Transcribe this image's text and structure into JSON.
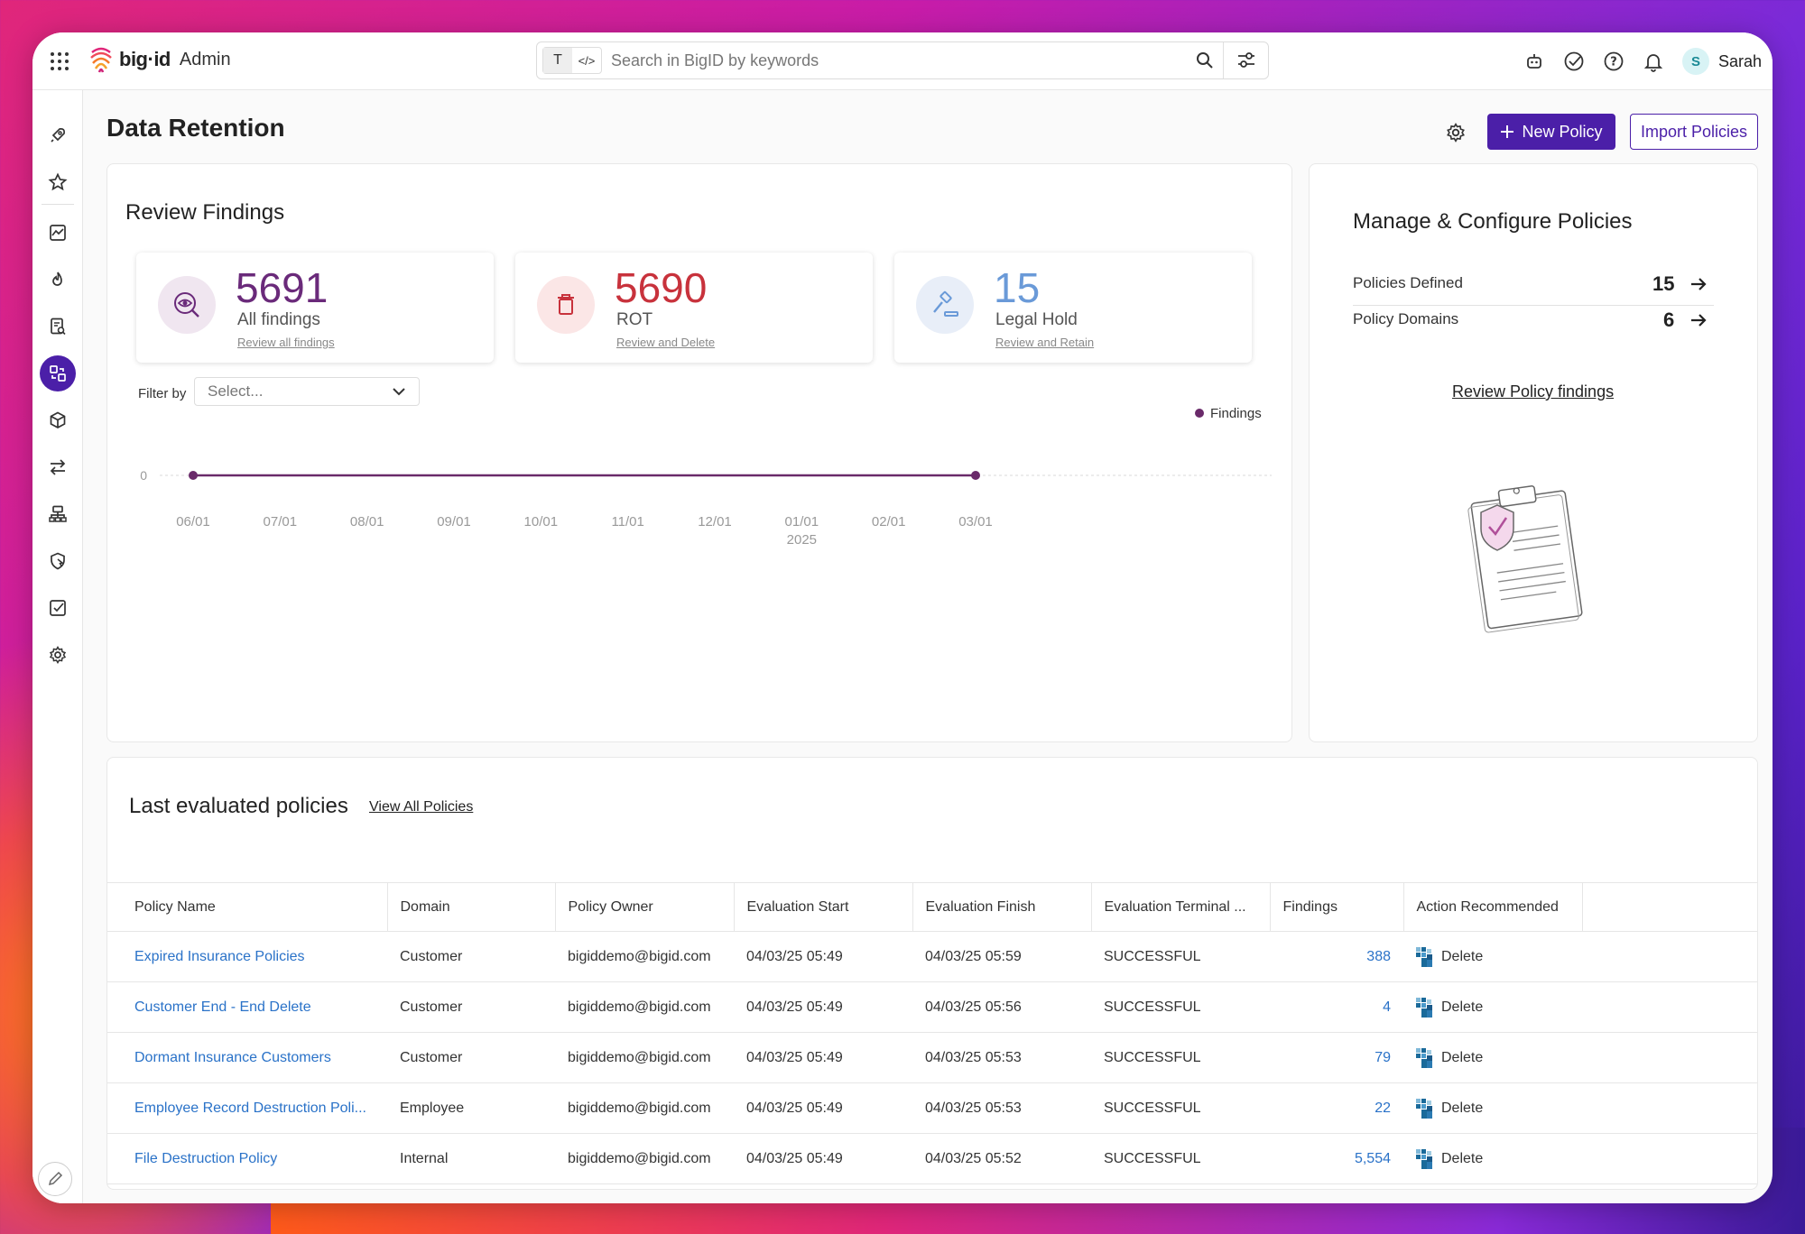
{
  "app": {
    "brand": "big·id",
    "product": "Admin",
    "user_initial": "S",
    "user_name": "Sarah"
  },
  "search": {
    "placeholder": "Search in BigID by keywords",
    "mode_text": "T",
    "mode_code": "</>"
  },
  "page": {
    "title": "Data Retention",
    "new_policy_label": "New Policy",
    "import_label": "Import Policies"
  },
  "review": {
    "title": "Review Findings",
    "stats": [
      {
        "value": "5691",
        "label": "All findings",
        "link": "Review all findings",
        "color": "#6a2a7a"
      },
      {
        "value": "5690",
        "label": "ROT",
        "link": "Review and Delete",
        "color": "#c8323c"
      },
      {
        "value": "15",
        "label": "Legal Hold",
        "link": "Review and Retain",
        "color": "#6a9ad8"
      }
    ],
    "filter_label": "Filter by",
    "filter_placeholder": "Select..."
  },
  "chart_data": {
    "type": "line",
    "x": [
      "06/01",
      "07/01",
      "08/01",
      "09/01",
      "10/01",
      "11/01",
      "12/01",
      "01/01 2025",
      "02/01",
      "03/01"
    ],
    "series": [
      {
        "name": "Findings",
        "values": [
          0,
          0,
          0,
          0,
          0,
          0,
          0,
          0,
          0,
          0
        ],
        "color": "#6a2a6a"
      }
    ],
    "y_ticks": [
      "0"
    ],
    "legend": "top-right",
    "markers_at_ends": true
  },
  "manage": {
    "title": "Manage & Configure Policies",
    "rows": [
      {
        "label": "Policies Defined",
        "value": "15"
      },
      {
        "label": "Policy Domains",
        "value": "6"
      }
    ],
    "link": "Review Policy findings"
  },
  "evaluated": {
    "title": "Last evaluated policies",
    "view_all": "View All Policies",
    "columns": [
      "Policy Name",
      "Domain",
      "Policy Owner",
      "Evaluation Start",
      "Evaluation Finish",
      "Evaluation Terminal ...",
      "Findings",
      "Action Recommended"
    ],
    "rows": [
      {
        "name": "Expired Insurance Policies",
        "domain": "Customer",
        "owner": "bigiddemo@bigid.com",
        "start": "04/03/25 05:49",
        "finish": "04/03/25 05:59",
        "status": "SUCCESSFUL",
        "findings": "388",
        "action": "Delete"
      },
      {
        "name": "Customer End - End Delete",
        "domain": "Customer",
        "owner": "bigiddemo@bigid.com",
        "start": "04/03/25 05:49",
        "finish": "04/03/25 05:56",
        "status": "SUCCESSFUL",
        "findings": "4",
        "action": "Delete"
      },
      {
        "name": "Dormant Insurance Customers",
        "domain": "Customer",
        "owner": "bigiddemo@bigid.com",
        "start": "04/03/25 05:49",
        "finish": "04/03/25 05:53",
        "status": "SUCCESSFUL",
        "findings": "79",
        "action": "Delete"
      },
      {
        "name": "Employee Record Destruction Poli...",
        "domain": "Employee",
        "owner": "bigiddemo@bigid.com",
        "start": "04/03/25 05:49",
        "finish": "04/03/25 05:53",
        "status": "SUCCESSFUL",
        "findings": "22",
        "action": "Delete"
      },
      {
        "name": "File Destruction Policy",
        "domain": "Internal",
        "owner": "bigiddemo@bigid.com",
        "start": "04/03/25 05:49",
        "finish": "04/03/25 05:52",
        "status": "SUCCESSFUL",
        "findings": "5,554",
        "action": "Delete"
      }
    ]
  },
  "colors": {
    "accent": "#4b1fa8",
    "link": "#2a72c8"
  }
}
